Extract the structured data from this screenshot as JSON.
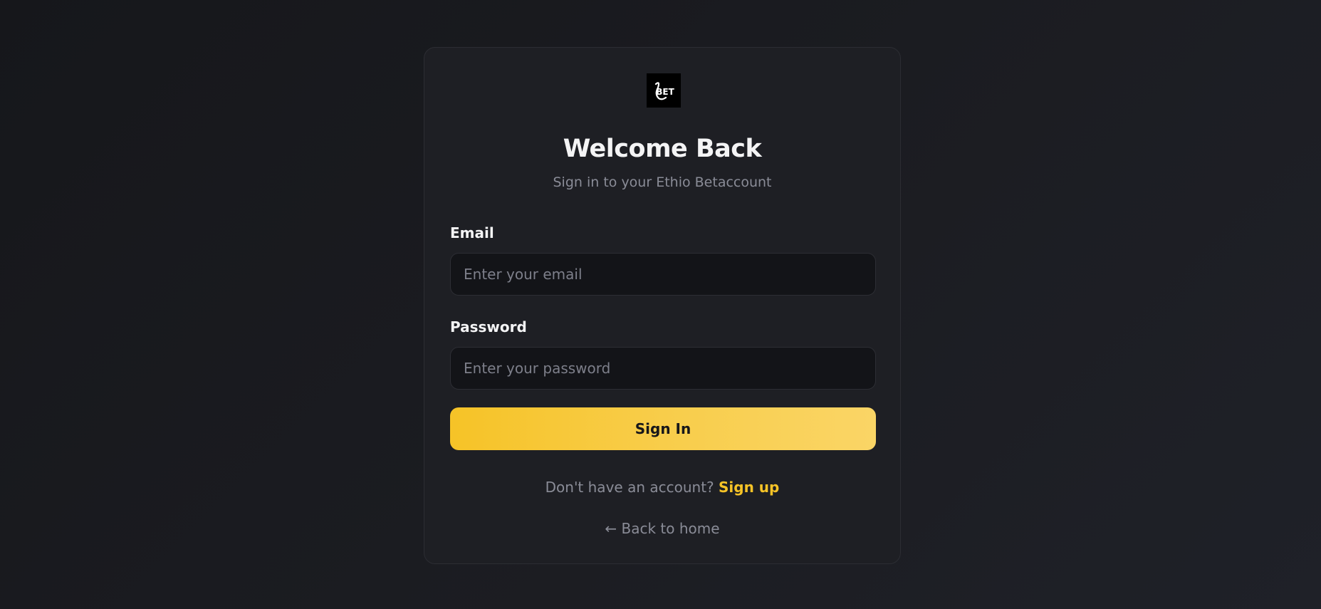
{
  "brand": {
    "logo_text": "BET",
    "icon": "bet-logo-icon"
  },
  "header": {
    "title": "Welcome Back",
    "subtitle": "Sign in to your Ethio Betaccount"
  },
  "form": {
    "email_label": "Email",
    "email_placeholder": "Enter your email",
    "email_value": "",
    "password_label": "Password",
    "password_placeholder": "Enter your password",
    "password_value": "",
    "submit_label": "Sign In"
  },
  "footer": {
    "signup_prompt": "Don't have an account? ",
    "signup_link": "Sign up",
    "back_link": "← Back to home"
  },
  "colors": {
    "accent": "#f6c327",
    "card_background": "#1e1f24",
    "page_background": "#1a1b20",
    "input_background": "#131418",
    "muted_text": "#8a8c97"
  }
}
